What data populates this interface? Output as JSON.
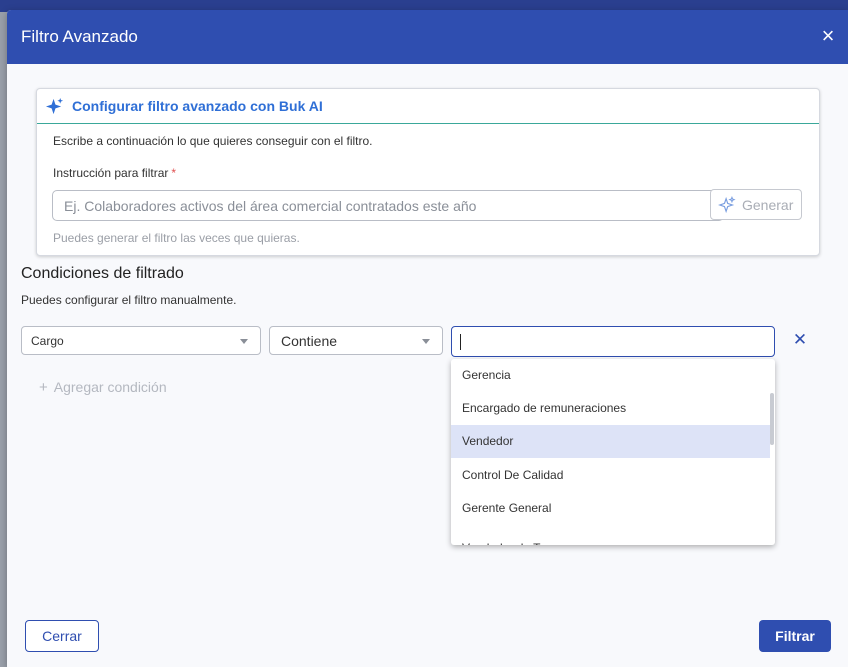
{
  "modal": {
    "title": "Filtro Avanzado",
    "close_symbol": "×"
  },
  "ai_card": {
    "title": "Configurar filtro avanzado con Buk AI",
    "description": "Escribe a continuación lo que quieres conseguir con el filtro.",
    "instruction_label": "Instrucción para filtrar",
    "required_mark": "*",
    "instruction_placeholder": "Ej. Colaboradores activos del área comercial contratados este año",
    "generate_label": "Generar",
    "hint": "Puedes generar el filtro las veces que quieras."
  },
  "conditions": {
    "title": "Condiciones de filtrado",
    "description": "Puedes configurar el filtro manualmente.",
    "field_value": "Cargo",
    "operator_value": "Contiene",
    "value_input": "",
    "add_label": "Agregar condición",
    "add_symbol": "+",
    "remove_symbol": "✕"
  },
  "dropdown": {
    "options": [
      "Gerencia",
      "Encargado de remuneraciones",
      "Vendedor",
      "Control De Calidad",
      "Gerente General",
      "Vendedor de Terreno"
    ],
    "highlighted_option": "Vendedor"
  },
  "footer": {
    "close_label": "Cerrar",
    "filter_label": "Filtrar"
  },
  "colors": {
    "primary": "#2f4eb0",
    "ai_accent": "#2f6fd6",
    "divider_teal": "#3aa89a",
    "highlight": "#dde3f7"
  }
}
